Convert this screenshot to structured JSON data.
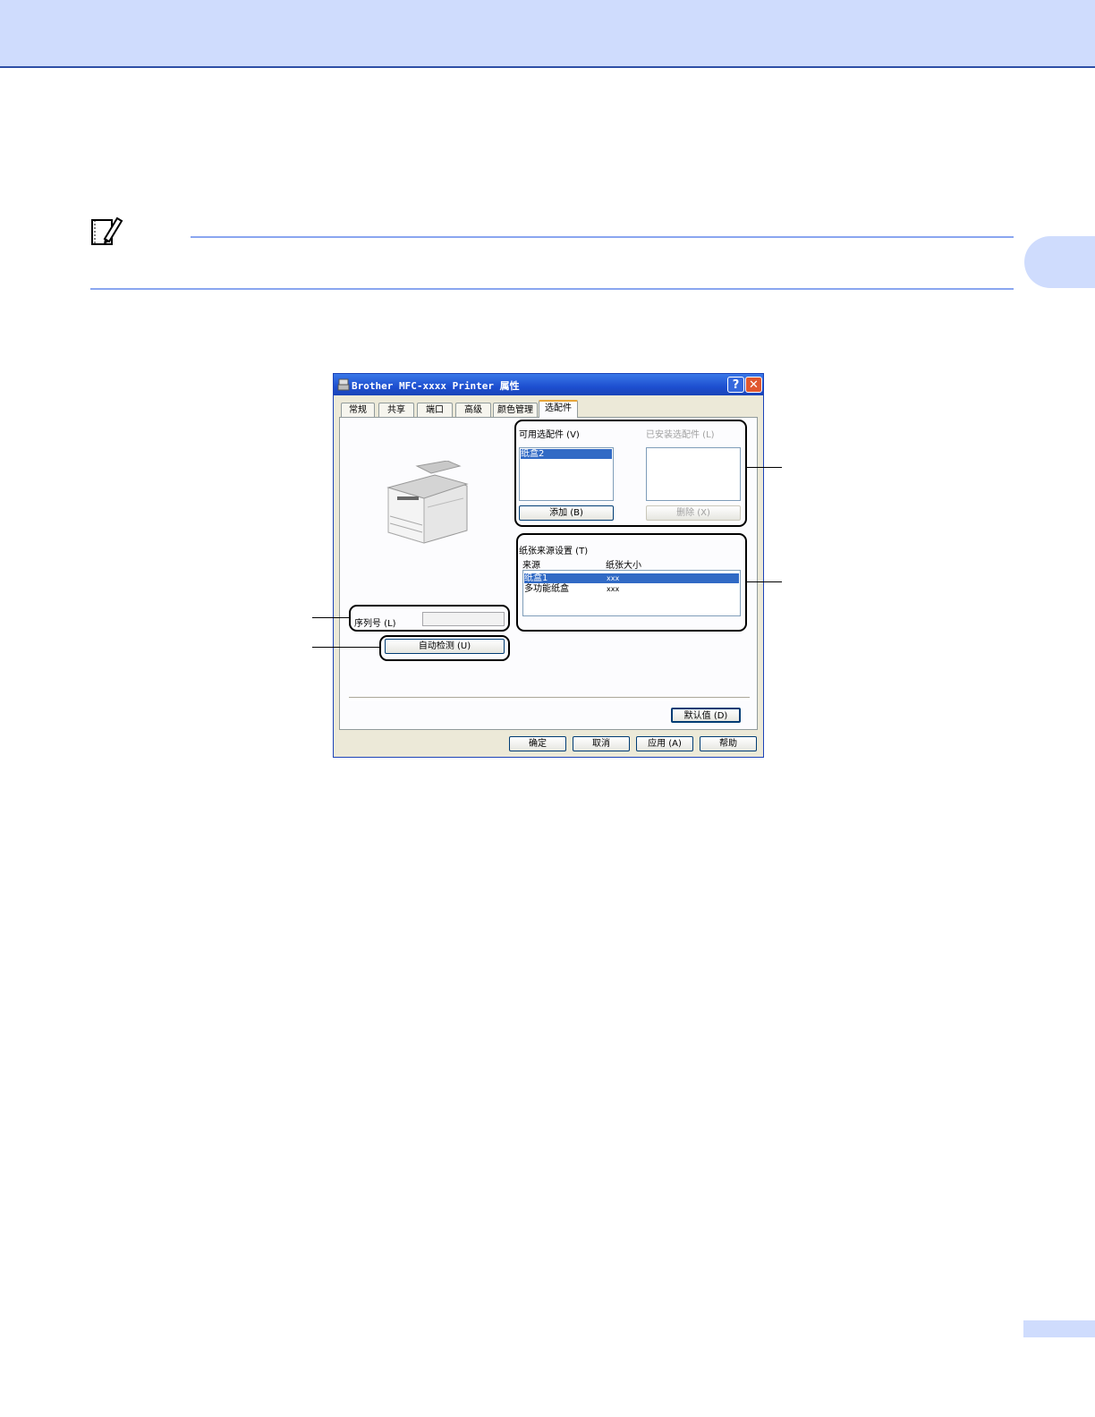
{
  "dialog": {
    "title": "Brother MFC-xxxx Printer 属性",
    "title_buttons": {
      "help": "?",
      "close": "✕"
    },
    "tabs": [
      "常规",
      "共享",
      "端口",
      "高级",
      "颜色管理",
      "选配件"
    ],
    "active_tab": "选配件",
    "available_options": {
      "label": "可用选配件 (V)",
      "items": [
        "纸盒2"
      ],
      "selected": "纸盒2",
      "add_button": "添加 (B)"
    },
    "installed_options": {
      "label": "已安装选配件 (L)",
      "items": [],
      "remove_button": "删除 (X)"
    },
    "paper_source": {
      "label": "纸张来源设置 (T)",
      "col_source": "来源",
      "col_size": "纸张大小",
      "rows": [
        {
          "source": "纸盒1",
          "size": "xxx"
        },
        {
          "source": "多功能纸盒",
          "size": "xxx"
        }
      ]
    },
    "serial": {
      "label": "序列号 (L)",
      "value": ""
    },
    "auto_detect_button": "自动检测 (U)",
    "default_button": "默认值 (D)",
    "ok_button": "确定",
    "cancel_button": "取消",
    "apply_button": "应用 (A)",
    "help_button": "帮助"
  },
  "colors": {
    "header_band": "#cfdcfd",
    "rule": "#8aa6f0",
    "selection": "#316ac5"
  },
  "icons": [
    "note-icon",
    "printer-image"
  ]
}
